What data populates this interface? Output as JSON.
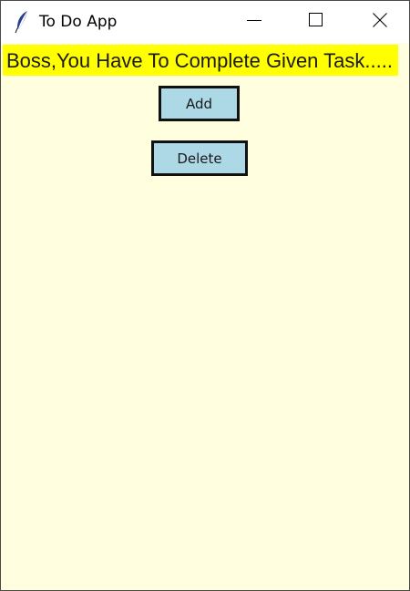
{
  "window": {
    "title": "To Do App",
    "app_icon": "feather-icon",
    "controls": {
      "minimize_icon": "minimize-icon",
      "maximize_icon": "maximize-icon",
      "close_icon": "close-icon"
    }
  },
  "content": {
    "background_color": "#ffffe0",
    "banner": {
      "text": "Boss,You Have To Complete Given Task.....",
      "background_color": "#ffff00"
    },
    "buttons": {
      "add_label": "Add",
      "delete_label": "Delete",
      "background_color": "#add8e6"
    }
  }
}
